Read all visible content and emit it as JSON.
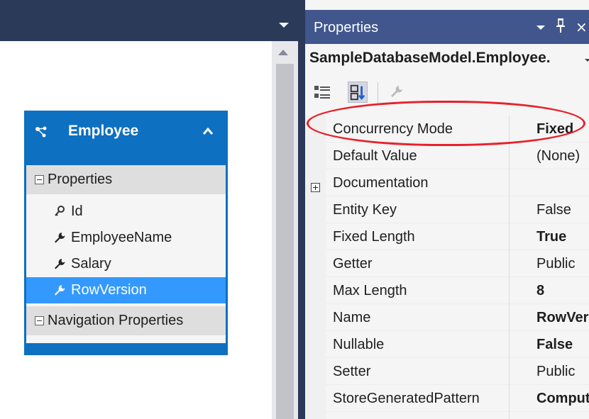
{
  "designer": {
    "entity": {
      "title": "Employee",
      "sections": [
        {
          "label": "Properties"
        },
        {
          "label": "Navigation Properties"
        }
      ],
      "properties": [
        {
          "label": "Id",
          "icon": "key-icon"
        },
        {
          "label": "EmployeeName",
          "icon": "wrench-icon"
        },
        {
          "label": "Salary",
          "icon": "wrench-icon"
        },
        {
          "label": "RowVersion",
          "icon": "wrench-icon",
          "selected": true
        }
      ]
    }
  },
  "properties_window": {
    "title": "Properties",
    "close_glyph": "×",
    "object": "SampleDatabaseModel.Employee.",
    "rows": [
      {
        "name": "Concurrency Mode",
        "value": "Fixed",
        "bold": true
      },
      {
        "name": "Default Value",
        "value": "(None)",
        "bold": false
      },
      {
        "name": "Documentation",
        "value": "",
        "bold": false,
        "expandable": true
      },
      {
        "name": "Entity Key",
        "value": "False",
        "bold": false
      },
      {
        "name": "Fixed Length",
        "value": "True",
        "bold": true
      },
      {
        "name": "Getter",
        "value": "Public",
        "bold": false
      },
      {
        "name": "Max Length",
        "value": "8",
        "bold": true
      },
      {
        "name": "Name",
        "value": "RowVersi",
        "bold": true
      },
      {
        "name": "Nullable",
        "value": "False",
        "bold": true
      },
      {
        "name": "Setter",
        "value": "Public",
        "bold": false
      },
      {
        "name": "StoreGeneratedPattern",
        "value": "Compute",
        "bold": true
      }
    ]
  },
  "colors": {
    "entity_blue": "#0e70c0",
    "selection_blue": "#3399ff",
    "titlebar": "#40568d",
    "annotation_red": "#e8202a"
  }
}
